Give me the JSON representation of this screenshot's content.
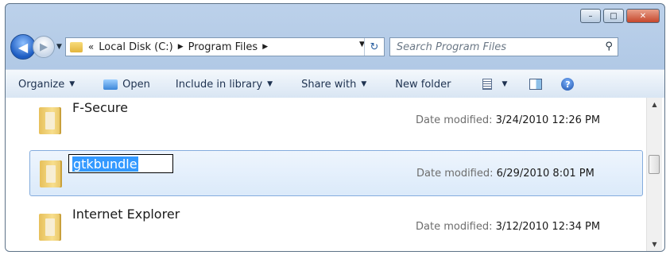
{
  "window": {
    "caption": {
      "minimize": "–",
      "maximize": "□",
      "close": "✕"
    }
  },
  "nav": {
    "back_glyph": "◀",
    "forward_glyph": "▶",
    "recent_glyph": "▼"
  },
  "address": {
    "overflow": "«",
    "crumbs": [
      "Local Disk (C:)",
      "Program Files"
    ],
    "separator": "▶",
    "dropdown_glyph": "▼",
    "refresh_glyph": "↻"
  },
  "search": {
    "placeholder": "Search Program Files",
    "icon_glyph": "⚲"
  },
  "toolbar": {
    "organize": "Organize",
    "open": "Open",
    "include_in_library": "Include in library",
    "share_with": "Share with",
    "new_folder": "New folder",
    "dropdown_glyph": "▼",
    "help_glyph": "?"
  },
  "files": [
    {
      "name": "F-Secure",
      "date_label": "Date modified: ",
      "date": "3/24/2010 12:26 PM"
    },
    {
      "name": "gtkbundle",
      "date_label": "Date modified: ",
      "date": "6/29/2010 8:01 PM"
    },
    {
      "name": "Internet Explorer",
      "date_label": "Date modified: ",
      "date": "3/12/2010 12:34 PM"
    }
  ],
  "scrollbar": {
    "up_glyph": "▲",
    "down_glyph": "▼"
  },
  "colors": {
    "selection_bg": "#dbeafa",
    "selection_border": "#84acdd",
    "rename_highlight": "#3399ff"
  }
}
